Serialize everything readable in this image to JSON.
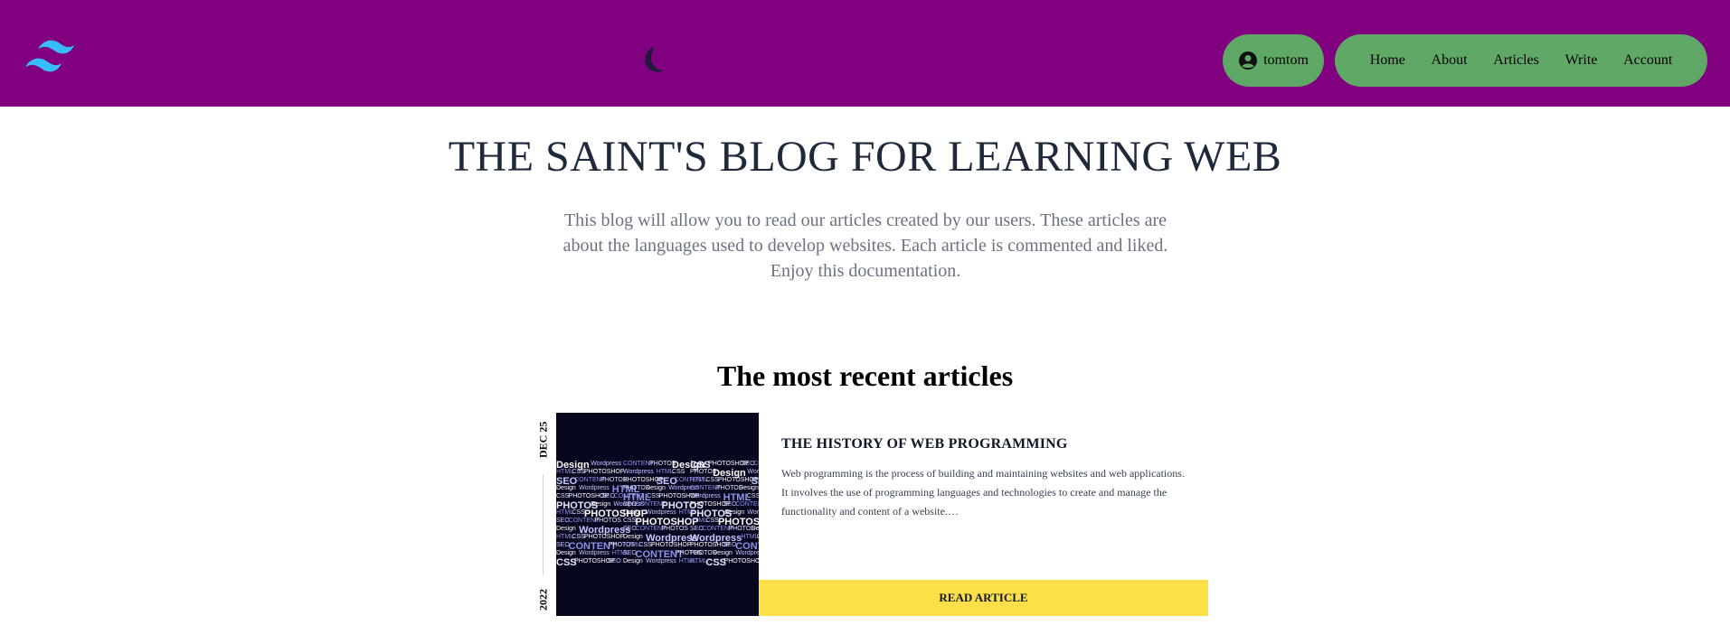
{
  "header": {
    "logo_icon": "tailwind-logo-icon",
    "theme_icon": "moon-icon",
    "user": {
      "icon": "user-circle-icon",
      "name": "tomtom"
    },
    "nav": [
      {
        "label": "Home"
      },
      {
        "label": "About"
      },
      {
        "label": "Articles"
      },
      {
        "label": "Write"
      },
      {
        "label": "Account"
      }
    ],
    "colors": {
      "bar": "#800080",
      "pill": "#5fa865",
      "logo": "#38bdf8"
    }
  },
  "hero": {
    "title": "THE SAINT'S BLOG FOR LEARNING WEB",
    "description": "This blog will allow you to read our articles created by our users. These articles are about the languages used to develop websites. Each article is commented and liked. Enjoy this documentation."
  },
  "recent": {
    "heading": "The most recent articles",
    "articles": [
      {
        "date_top": "DEC 25",
        "date_bottom": "2022",
        "title": "THE HISTORY OF WEB PROGRAMMING",
        "excerpt": "Web programming is the process of building and maintaining websites and web applications. It involves the use of programming languages and technologies to create and manage the functionality and content of a website.…",
        "button": "READ ARTICLE",
        "image_words": [
          "Design",
          "Wordpress",
          "HTML",
          "CSS",
          "PHOTOSHOP",
          "SEO",
          "CONTENT",
          "PHOTOS"
        ],
        "button_color": "#fde047"
      }
    ]
  }
}
